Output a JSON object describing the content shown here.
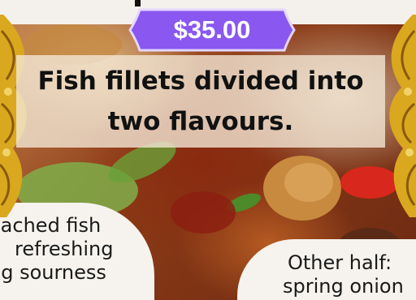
{
  "price": "$35.00",
  "title": {
    "line1": "Fish fillets divided into",
    "line2": "two flavours."
  },
  "caption_left": {
    "line1": "oached fish",
    "line2": "refreshing",
    "line3": "ng sourness"
  },
  "caption_right": {
    "line1": "Other half:",
    "line2": "spring onion"
  },
  "colors": {
    "price_badge": "#8a57f0",
    "ornament_gold": "#d9a81e",
    "title_panel": "#f2e6d4"
  }
}
